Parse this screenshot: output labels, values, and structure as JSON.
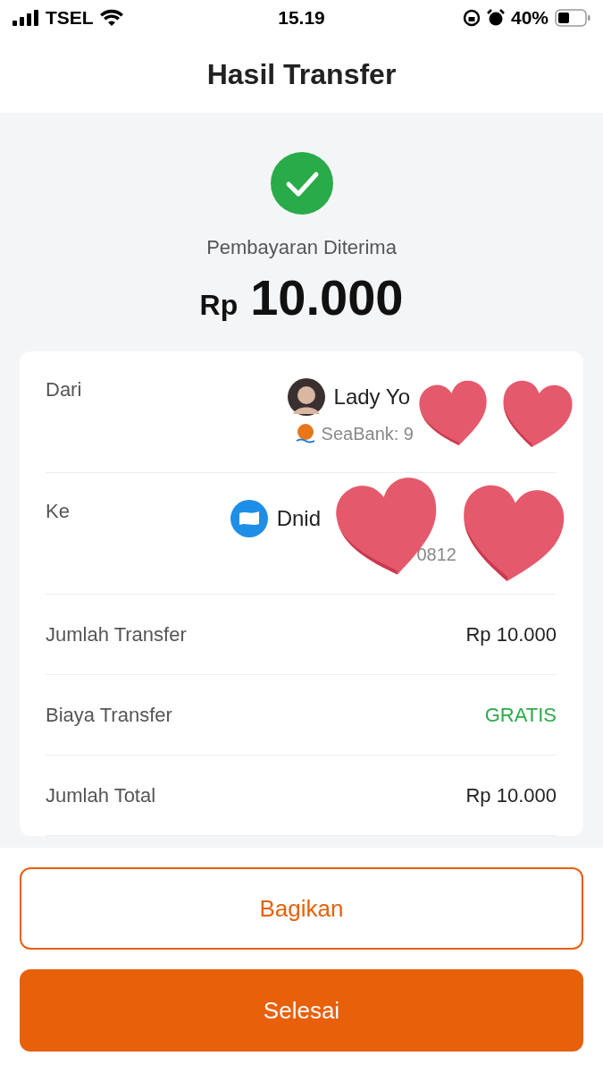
{
  "status_bar": {
    "carrier": "TSEL",
    "time": "15.19",
    "battery": "40%"
  },
  "header": {
    "title": "Hasil Transfer"
  },
  "result": {
    "status": "Pembayaran Diterima",
    "currency": "Rp",
    "amount": "10.000"
  },
  "parties": [
    {
      "label": "Dari",
      "kind": "photo",
      "name": "Lady Yo",
      "account": "SeaBank: 9"
    },
    {
      "label": "Ke",
      "kind": "wallet",
      "name": "Dnid",
      "account": "0812"
    }
  ],
  "rows": [
    {
      "label": "Jumlah Transfer",
      "value": "Rp 10.000",
      "kind": "plain"
    },
    {
      "label": "Biaya Transfer",
      "value": "GRATIS",
      "kind": "free"
    },
    {
      "label": "Jumlah Total",
      "value": "Rp 10.000",
      "kind": "plain"
    }
  ],
  "buttons": [
    {
      "label": "Bagikan",
      "kind": "outline"
    },
    {
      "label": "Selesai",
      "kind": "primary"
    }
  ]
}
